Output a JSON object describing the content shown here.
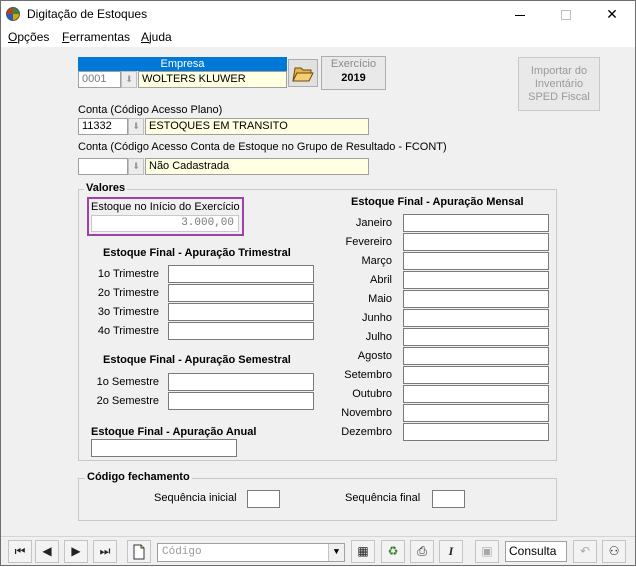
{
  "window": {
    "title": "Digitação de Estoques"
  },
  "menu": {
    "items": [
      {
        "label_u": "O",
        "label_rest": "pções"
      },
      {
        "label_u": "F",
        "label_rest": "erramentas"
      },
      {
        "label_u": "A",
        "label_rest": "juda"
      }
    ]
  },
  "empresa": {
    "header": "Empresa",
    "code": "0001",
    "name": "WOLTERS KLUWER"
  },
  "exercicio": {
    "label": "Exercício",
    "year": "2019"
  },
  "sped_button": {
    "line1": "Importar do",
    "line2": "Inventário",
    "line3": "SPED Fiscal"
  },
  "conta": {
    "label": "Conta (Código Acesso Plano)",
    "code": "11332",
    "name": "ESTOQUES EM TRANSITO"
  },
  "conta_fcont": {
    "label": "Conta (Código Acesso Conta de Estoque no Grupo de Resultado - FCONT)",
    "code": "",
    "name": "Não Cadastrada"
  },
  "valores": {
    "title": "Valores",
    "estoque_inicio_label": "Estoque no Início do Exercício",
    "estoque_inicio_value": "3.000,00",
    "trimestral_title": "Estoque Final - Apuração Trimestral",
    "trimestres": [
      "1o Trimestre",
      "2o Trimestre",
      "3o Trimestre",
      "4o Trimestre"
    ],
    "semestral_title": "Estoque Final - Apuração Semestral",
    "semestres": [
      "1o Semestre",
      "2o Semestre"
    ],
    "anual_title": "Estoque Final - Apuração Anual",
    "mensal_title": "Estoque Final - Apuração Mensal",
    "meses": [
      "Janeiro",
      "Fevereiro",
      "Março",
      "Abril",
      "Maio",
      "Junho",
      "Julho",
      "Agosto",
      "Setembro",
      "Outubro",
      "Novembro",
      "Dezembro"
    ]
  },
  "codigo_fechamento": {
    "title": "Código fechamento",
    "seq_inicial_label": "Sequência inicial",
    "seq_final_label": "Sequência final"
  },
  "toolbar": {
    "combo_placeholder": "Código",
    "mode": "Consulta"
  },
  "colors": {
    "accent": "#0078d7",
    "highlight": "#a040a8",
    "field_yellow": "#ffffe1"
  }
}
